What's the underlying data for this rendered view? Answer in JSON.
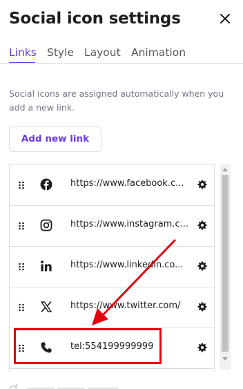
{
  "panel": {
    "title": "Social icon settings",
    "close_icon": "close-icon"
  },
  "tabs": [
    {
      "label": "Links",
      "active": true
    },
    {
      "label": "Style",
      "active": false
    },
    {
      "label": "Layout",
      "active": false
    },
    {
      "label": "Animation",
      "active": false
    }
  ],
  "help_text": "Social icons are assigned automatically when you add a new link.",
  "add_button": {
    "label": "Add new link"
  },
  "links": [
    {
      "icon": "facebook-icon",
      "url": "https://www.facebook.c..."
    },
    {
      "icon": "instagram-icon",
      "url": "https://www.instagram.c..."
    },
    {
      "icon": "linkedin-icon",
      "url": "https://www.linkedin.co..."
    },
    {
      "icon": "x-icon",
      "url": "https://www.twitter.com/"
    },
    {
      "icon": "phone-icon",
      "url": "tel:554199999999"
    }
  ],
  "annotation": {
    "color": "#e3000f",
    "highlighted_link": "tel:554199999999"
  },
  "colors": {
    "accent": "#673de6",
    "text": "#1d1e20",
    "muted": "#727586",
    "border": "#dadce0"
  }
}
